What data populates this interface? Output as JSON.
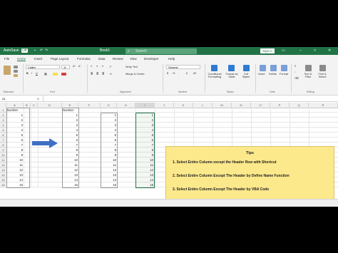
{
  "app": {
    "autosave_label": "AutoSave",
    "autosave_state": "Off",
    "file_name": "Book1",
    "search_placeholder": "Search",
    "signin_label": "Sign in"
  },
  "menu": {
    "tabs": [
      "File",
      "Home",
      "Insert",
      "Page Layout",
      "Formulas",
      "Data",
      "Review",
      "View",
      "Developer",
      "Help"
    ],
    "active_index": 1
  },
  "ribbon": {
    "font_name": "Calibri",
    "font_size": "11",
    "wrap_text": "Wrap Text",
    "merge_center": "Merge & Center",
    "number_format": "General",
    "cond_format": "Conditional Formatting",
    "format_table": "Format as Table",
    "cell_styles": "Cell Styles",
    "insert": "Insert",
    "delete": "Delete",
    "format": "Format",
    "sort_filter": "Sort & Filter",
    "find_select": "Find & Select",
    "groups": [
      "Clipboard",
      "Font",
      "Alignment",
      "Number",
      "Styles",
      "Cells",
      "Editing"
    ]
  },
  "formula_bar": {
    "name_box": "A1",
    "fx": "fx"
  },
  "grid": {
    "columns": [
      "A",
      "B",
      "C",
      "D",
      "E",
      "F",
      "G",
      "H",
      "I",
      "J",
      "K",
      "L",
      "M",
      "N",
      "O",
      "P",
      "Q",
      "R"
    ],
    "rows": [
      "1",
      "2",
      "3",
      "4",
      "5",
      "6",
      "7",
      "8",
      "9",
      "10",
      "11",
      "12",
      "13",
      "14",
      "15",
      "16"
    ],
    "header_label": "Number",
    "values": [
      "1",
      "2",
      "3",
      "4",
      "5",
      "6",
      "7",
      "8",
      "9",
      "10",
      "11",
      "12",
      "13",
      "14",
      "15"
    ]
  },
  "tips": {
    "title": "Tips",
    "items": [
      "1. Select Entire Column except the Header Row with Shortcut",
      "2. Select Entire Column Except The Header by Define Name Function",
      "3. Select Entire Column Except The Header by VBA Code"
    ]
  },
  "colors": {
    "excel_green": "#217346",
    "tips_bg": "#fce98c",
    "arrow": "#3f6fc4"
  }
}
